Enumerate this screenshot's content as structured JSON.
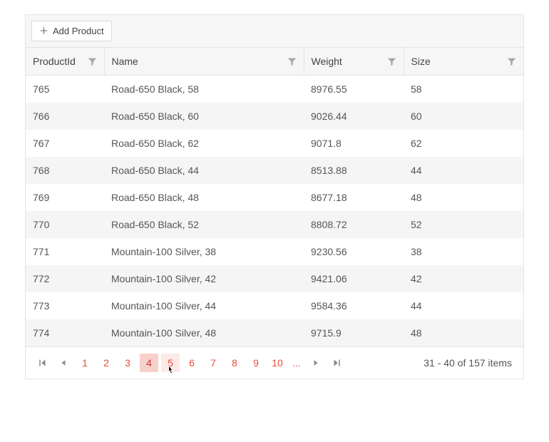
{
  "toolbar": {
    "add_label": "Add Product"
  },
  "columns": [
    {
      "key": "id",
      "label": "ProductId"
    },
    {
      "key": "name",
      "label": "Name"
    },
    {
      "key": "weight",
      "label": "Weight"
    },
    {
      "key": "size",
      "label": "Size"
    }
  ],
  "rows": [
    {
      "id": "765",
      "name": "Road-650 Black, 58",
      "weight": "8976.55",
      "size": "58"
    },
    {
      "id": "766",
      "name": "Road-650 Black, 60",
      "weight": "9026.44",
      "size": "60"
    },
    {
      "id": "767",
      "name": "Road-650 Black, 62",
      "weight": "9071.8",
      "size": "62"
    },
    {
      "id": "768",
      "name": "Road-650 Black, 44",
      "weight": "8513.88",
      "size": "44"
    },
    {
      "id": "769",
      "name": "Road-650 Black, 48",
      "weight": "8677.18",
      "size": "48"
    },
    {
      "id": "770",
      "name": "Road-650 Black, 52",
      "weight": "8808.72",
      "size": "52"
    },
    {
      "id": "771",
      "name": "Mountain-100 Silver, 38",
      "weight": "9230.56",
      "size": "38"
    },
    {
      "id": "772",
      "name": "Mountain-100 Silver, 42",
      "weight": "9421.06",
      "size": "42"
    },
    {
      "id": "773",
      "name": "Mountain-100 Silver, 44",
      "weight": "9584.36",
      "size": "44"
    },
    {
      "id": "774",
      "name": "Mountain-100 Silver, 48",
      "weight": "9715.9",
      "size": "48"
    }
  ],
  "pager": {
    "pages": [
      "1",
      "2",
      "3",
      "4",
      "5",
      "6",
      "7",
      "8",
      "9",
      "10"
    ],
    "selected": "4",
    "hover": "5",
    "more": "...",
    "info": "31 - 40 of 157 items"
  }
}
